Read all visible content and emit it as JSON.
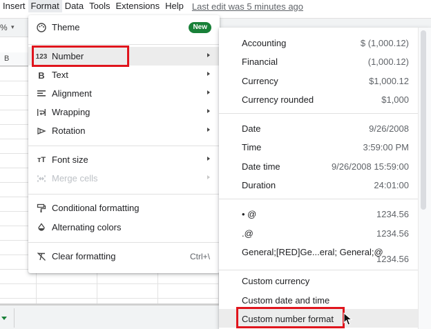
{
  "menubar": {
    "items": [
      {
        "label": "Insert"
      },
      {
        "label": "Format",
        "active": true
      },
      {
        "label": "Data"
      },
      {
        "label": "Tools"
      },
      {
        "label": "Extensions"
      },
      {
        "label": "Help"
      }
    ],
    "last_edit": "Last edit was 5 minutes ago"
  },
  "toolbar": {
    "zoom_fragment": "%"
  },
  "sheet": {
    "column_b": "B"
  },
  "format_menu": {
    "theme": {
      "label": "Theme",
      "icon": "palette-icon",
      "badge": "New"
    },
    "number": {
      "label": "Number",
      "icon": "123-icon"
    },
    "text": {
      "label": "Text",
      "icon": "bold-icon"
    },
    "alignment": {
      "label": "Alignment",
      "icon": "align-left-icon"
    },
    "wrapping": {
      "label": "Wrapping",
      "icon": "wrap-icon"
    },
    "rotation": {
      "label": "Rotation",
      "icon": "rotate-icon"
    },
    "font_size": {
      "label": "Font size",
      "icon": "font-size-icon"
    },
    "merge_cells": {
      "label": "Merge cells",
      "icon": "merge-icon",
      "disabled": true
    },
    "conditional_formatting": {
      "label": "Conditional formatting",
      "icon": "paint-roller-icon"
    },
    "alternating_colors": {
      "label": "Alternating colors",
      "icon": "color-drop-icon"
    },
    "clear_formatting": {
      "label": "Clear formatting",
      "icon": "clear-format-icon",
      "shortcut": "Ctrl+\\"
    }
  },
  "number_submenu": {
    "accounting": {
      "label": "Accounting",
      "example": "$ (1,000.12)"
    },
    "financial": {
      "label": "Financial",
      "example": "(1,000.12)"
    },
    "currency": {
      "label": "Currency",
      "example": "$1,000.12"
    },
    "currency_rounded": {
      "label": "Currency rounded",
      "example": "$1,000"
    },
    "date": {
      "label": "Date",
      "example": "9/26/2008"
    },
    "time": {
      "label": "Time",
      "example": "3:59:00 PM"
    },
    "date_time": {
      "label": "Date time",
      "example": "9/26/2008 15:59:00"
    },
    "duration": {
      "label": "Duration",
      "example": "24:01:00"
    },
    "custom_1": {
      "label": "• @",
      "example": "1234.56"
    },
    "custom_2": {
      "label": ".@",
      "example": "1234.56"
    },
    "custom_3": {
      "label": "General;[RED]Ge...eral; General;@",
      "example": "1234.56"
    },
    "custom_currency": {
      "label": "Custom currency"
    },
    "custom_date_time": {
      "label": "Custom date and time"
    },
    "custom_number_format": {
      "label": "Custom number format"
    }
  },
  "colors": {
    "highlight_box": "#e0141c",
    "new_badge": "#188038",
    "hover": "#ececec"
  }
}
